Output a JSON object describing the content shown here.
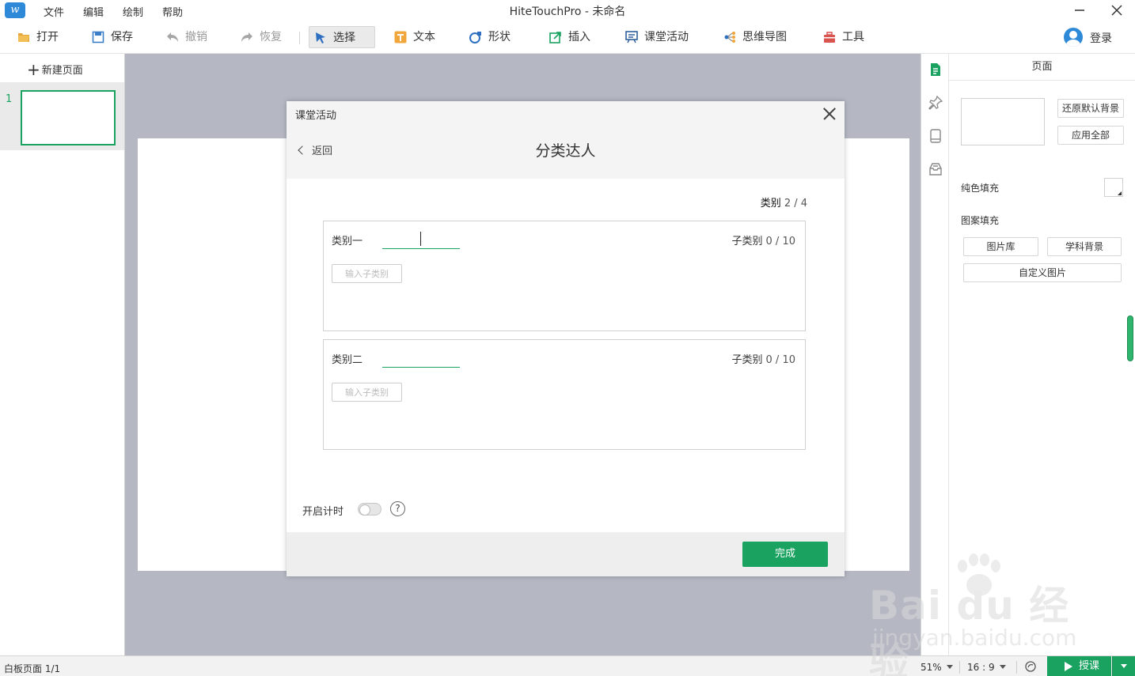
{
  "app": {
    "title": "HiteTouchPro - 未命名",
    "menu": [
      "文件",
      "编辑",
      "绘制",
      "帮助"
    ]
  },
  "toolbar": {
    "open": "打开",
    "save": "保存",
    "undo": "撤销",
    "redo": "恢复",
    "select": "选择",
    "text": "文本",
    "shape": "形状",
    "insert": "插入",
    "activity": "课堂活动",
    "mindmap": "思维导图",
    "tools": "工具",
    "login": "登录"
  },
  "left_panel": {
    "new_page": "新建页面",
    "pages": [
      {
        "number": "1"
      }
    ]
  },
  "right_panel": {
    "title": "页面",
    "restore_bg": "还原默认背景",
    "apply_all": "应用全部",
    "solid_fill": "纯色填充",
    "pattern_fill": "图案填充",
    "image_library": "图片库",
    "subject_bg": "学科背景",
    "custom_image": "自定义图片"
  },
  "dialog": {
    "title": "课堂活动",
    "back": "返回",
    "heading": "分类达人",
    "category_counter_label": "类别",
    "category_counter_value": "2 / 4",
    "categories": [
      {
        "label": "类别一",
        "value": "",
        "sub_label": "子类别",
        "sub_count": "0 / 10",
        "sub_placeholder": "输入子类别"
      },
      {
        "label": "类别二",
        "value": "",
        "sub_label": "子类别",
        "sub_count": "0 / 10",
        "sub_placeholder": "输入子类别"
      }
    ],
    "timer_label": "开启计时",
    "timer_on": false,
    "help": "?",
    "done": "完成"
  },
  "statusbar": {
    "page_info": "白板页面 1/1",
    "zoom": "51%",
    "ratio": "16 : 9",
    "teach": "授课"
  },
  "watermark": {
    "brand": "Bai du 经验",
    "url": "jingyan.baidu.com"
  },
  "colors": {
    "accent": "#1aa260",
    "canvas_bg": "#b5b8c3",
    "brand_blue": "#2e8ad8"
  }
}
